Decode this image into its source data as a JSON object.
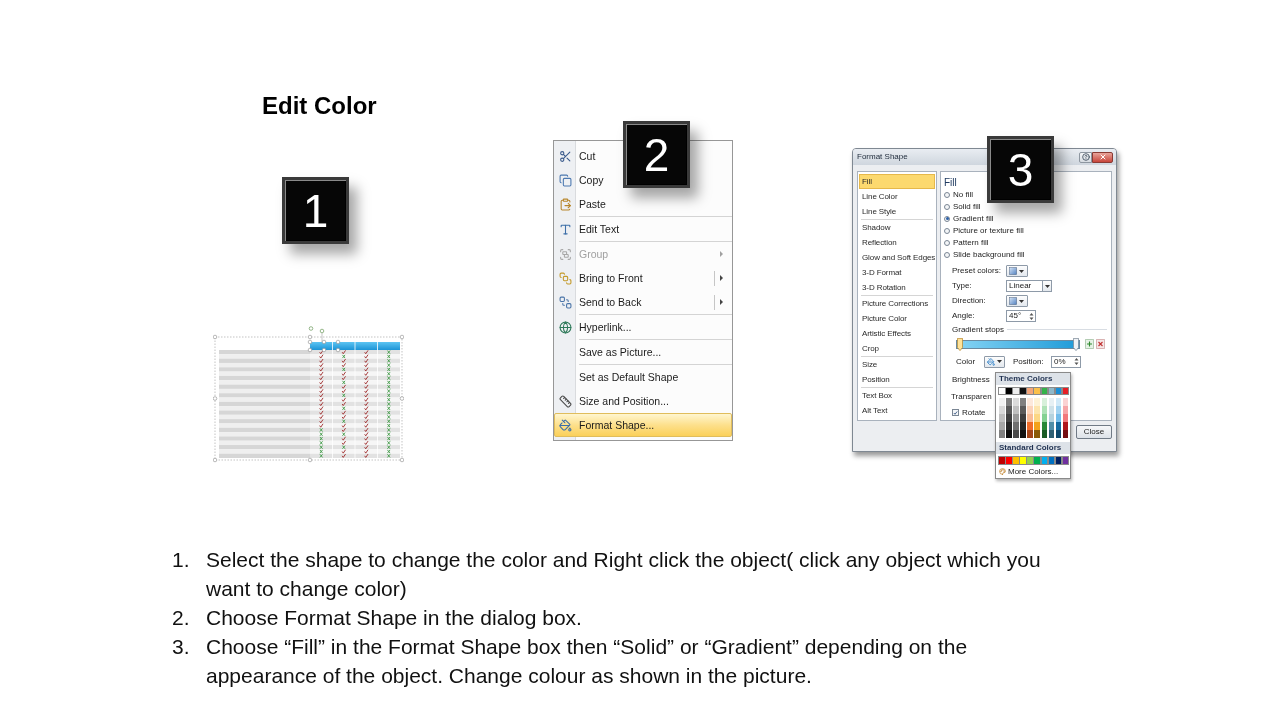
{
  "title": "Edit Color",
  "figures": [
    {
      "kind": "table",
      "badge": "1"
    },
    {
      "kind": "context_menu",
      "badge": "2",
      "menu": {
        "groups": [
          {
            "items": [
              {
                "label": "Cut",
                "kind": "plain",
                "disabled": false,
                "selected": false
              },
              {
                "label": "Copy",
                "kind": "plain",
                "disabled": false,
                "selected": false
              },
              {
                "label": "Paste",
                "kind": "plain",
                "disabled": false,
                "selected": false
              }
            ]
          },
          {
            "items": [
              {
                "label": "Edit Text",
                "kind": "plain",
                "disabled": false,
                "selected": false
              }
            ]
          },
          {
            "items": [
              {
                "label": "Group",
                "kind": "submenu",
                "disabled": true,
                "selected": false
              },
              {
                "label": "Bring to Front",
                "kind": "split",
                "disabled": false,
                "selected": false
              },
              {
                "label": "Send to Back",
                "kind": "split",
                "disabled": false,
                "selected": false
              }
            ]
          },
          {
            "items": [
              {
                "label": "Hyperlink...",
                "kind": "plain",
                "disabled": false,
                "selected": false
              }
            ]
          },
          {
            "items": [
              {
                "label": "Save as Picture...",
                "kind": "plain",
                "disabled": false,
                "selected": false
              }
            ]
          },
          {
            "items": [
              {
                "label": "Set as Default Shape",
                "kind": "plain",
                "disabled": false,
                "selected": false
              },
              {
                "label": "Size and Position...",
                "kind": "plain",
                "disabled": false,
                "selected": false
              },
              {
                "label": "Format Shape...",
                "kind": "plain",
                "disabled": false,
                "selected": true
              }
            ]
          }
        ]
      }
    },
    {
      "kind": "dialog",
      "badge": "3",
      "dialog": {
        "title": "Format Shape",
        "nav": {
          "groups": [
            {
              "items": [
                {
                  "label": "Fill",
                  "selected": true
                },
                {
                  "label": "Line Color",
                  "selected": false
                },
                {
                  "label": "Line Style",
                  "selected": false
                }
              ]
            },
            {
              "items": [
                {
                  "label": "Shadow",
                  "selected": false
                },
                {
                  "label": "Reflection",
                  "selected": false
                },
                {
                  "label": "Glow and Soft Edges",
                  "selected": false
                },
                {
                  "label": "3-D Format",
                  "selected": false
                },
                {
                  "label": "3-D Rotation",
                  "selected": false
                }
              ]
            },
            {
              "items": [
                {
                  "label": "Picture Corrections",
                  "selected": false
                },
                {
                  "label": "Picture Color",
                  "selected": false
                },
                {
                  "label": "Artistic Effects",
                  "selected": false
                },
                {
                  "label": "Crop",
                  "selected": false
                }
              ]
            },
            {
              "items": [
                {
                  "label": "Size",
                  "selected": false
                },
                {
                  "label": "Position",
                  "selected": false
                }
              ]
            },
            {
              "items": [
                {
                  "label": "Text Box",
                  "selected": false
                },
                {
                  "label": "Alt Text",
                  "selected": false
                }
              ]
            }
          ]
        },
        "fill": {
          "heading": "Fill",
          "options": [
            {
              "label": "No fill",
              "selected": false
            },
            {
              "label": "Solid fill",
              "selected": false
            },
            {
              "label": "Gradient fill",
              "selected": true
            },
            {
              "label": "Picture or texture fill",
              "selected": false
            },
            {
              "label": "Pattern fill",
              "selected": false
            },
            {
              "label": "Slide background fill",
              "selected": false
            }
          ],
          "preset_colors": {
            "label": "Preset colors:"
          },
          "type": {
            "label": "Type:",
            "value": "Linear"
          },
          "direction": {
            "label": "Direction:"
          },
          "angle": {
            "label": "Angle:",
            "value": "45°"
          },
          "gradient_stops": {
            "label": "Gradient stops",
            "stops": [
              {
                "level": 0,
                "selected": true
              },
              {
                "level": 1,
                "selected": false
              }
            ]
          },
          "stop_color": {
            "label": "Color"
          },
          "stop_position": {
            "label": "Position:",
            "value": "0%"
          },
          "brightness": {
            "label": "Brightness"
          },
          "transparency": {
            "label": "Transparen"
          },
          "rotate_with_shape": {
            "label": "Rotate",
            "checked": true
          }
        },
        "close_button": "Close",
        "color_picker": {
          "theme_heading": "Theme Colors",
          "theme_colors": [
            {
              "color": "#ffffff",
              "shades": [
                {
                  "color": "#f2f2f2"
                },
                {
                  "color": "#d9d9d9"
                },
                {
                  "color": "#bfbfbf"
                },
                {
                  "color": "#a6a6a6"
                },
                {
                  "color": "#808080"
                }
              ]
            },
            {
              "color": "#000000",
              "shades": [
                {
                  "color": "#7f7f7f"
                },
                {
                  "color": "#595959"
                },
                {
                  "color": "#404040"
                },
                {
                  "color": "#262626"
                },
                {
                  "color": "#0d0d0d"
                }
              ]
            },
            {
              "color": "#eeeeee",
              "shades": [
                {
                  "color": "#dcdcdc"
                },
                {
                  "color": "#c0c0c0"
                },
                {
                  "color": "#9a9a9a"
                },
                {
                  "color": "#707070"
                },
                {
                  "color": "#4a4a4a"
                }
              ]
            },
            {
              "color": "#111111",
              "shades": [
                {
                  "color": "#808080"
                },
                {
                  "color": "#5a5a5a"
                },
                {
                  "color": "#3d3d3d"
                },
                {
                  "color": "#262626"
                },
                {
                  "color": "#111111"
                }
              ]
            },
            {
              "color": "#f4a67a",
              "shades": [
                {
                  "color": "#fde9dc"
                },
                {
                  "color": "#fbd3ba"
                },
                {
                  "color": "#f8bc97"
                },
                {
                  "color": "#ef6c2a"
                },
                {
                  "color": "#a5461b"
                }
              ]
            },
            {
              "color": "#fbc04a",
              "shades": [
                {
                  "color": "#fef2d6"
                },
                {
                  "color": "#fde5ad"
                },
                {
                  "color": "#fcd784"
                },
                {
                  "color": "#f3a21b"
                },
                {
                  "color": "#8a5a08"
                }
              ]
            },
            {
              "color": "#33b44a",
              "shades": [
                {
                  "color": "#d7f0db"
                },
                {
                  "color": "#aee2b7"
                },
                {
                  "color": "#84d293"
                },
                {
                  "color": "#278a38"
                },
                {
                  "color": "#1a5c25"
                }
              ]
            },
            {
              "color": "#8fb8c9",
              "shades": [
                {
                  "color": "#e6f0f4"
                },
                {
                  "color": "#cde1e9"
                },
                {
                  "color": "#b4d2de"
                },
                {
                  "color": "#4f8ea8"
                },
                {
                  "color": "#2e5f73"
                }
              ]
            },
            {
              "color": "#1b8fd6",
              "shades": [
                {
                  "color": "#d0e9f8"
                },
                {
                  "color": "#a2d3f1"
                },
                {
                  "color": "#72bcea"
                },
                {
                  "color": "#146ba1"
                },
                {
                  "color": "#0d476b"
                }
              ]
            },
            {
              "color": "#e81e25",
              "shades": [
                {
                  "color": "#fbd2d3"
                },
                {
                  "color": "#f6a5a8"
                },
                {
                  "color": "#f2787c"
                },
                {
                  "color": "#b0151b"
                },
                {
                  "color": "#750e12"
                }
              ]
            }
          ],
          "standard_heading": "Standard Colors",
          "standard_colors": [
            {
              "color": "#c00000"
            },
            {
              "color": "#ff0000"
            },
            {
              "color": "#ffc000"
            },
            {
              "color": "#ffff00"
            },
            {
              "color": "#92d050"
            },
            {
              "color": "#00b050"
            },
            {
              "color": "#00b0f0"
            },
            {
              "color": "#0070c0"
            },
            {
              "color": "#002060"
            },
            {
              "color": "#7030a0"
            }
          ],
          "more_colors": "More Colors..."
        }
      }
    }
  ],
  "instructions": [
    {
      "number": "1.",
      "text": "Select the shape to change the color and Right click the object( click any object which you want to change color)"
    },
    {
      "number": "2.",
      "text": "Choose Format Shape in the dialog box."
    },
    {
      "number": "3.",
      "text": "Choose “Fill” in the Format Shape box then “Solid” or “Gradient” depending on the appearance of the object. Change colour as shown in the picture."
    }
  ]
}
